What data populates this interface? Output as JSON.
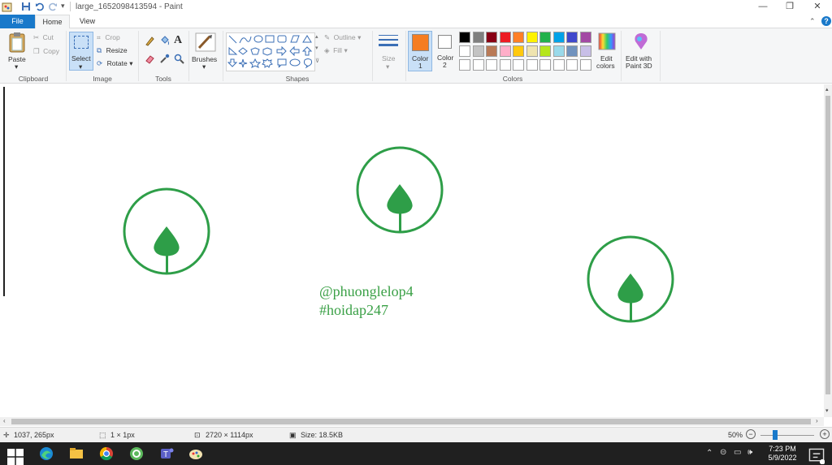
{
  "window": {
    "title": "large_1652098413594 - Paint"
  },
  "tabs": {
    "file": "File",
    "home": "Home",
    "view": "View"
  },
  "clipboard": {
    "paste": "Paste",
    "cut": "Cut",
    "copy": "Copy",
    "label": "Clipboard"
  },
  "image": {
    "select": "Select",
    "crop": "Crop",
    "resize": "Resize",
    "rotate": "Rotate",
    "label": "Image"
  },
  "tools": {
    "label": "Tools"
  },
  "brushes": {
    "label": "Brushes"
  },
  "shapes": {
    "outline": "Outline",
    "fill": "Fill",
    "label": "Shapes"
  },
  "size": {
    "label": "Size"
  },
  "colors": {
    "color1_label": "Color",
    "color1_num": "1",
    "color2_label": "Color",
    "color2_num": "2",
    "color1_value": "#f57d22",
    "color2_value": "#ffffff",
    "edit_colors_1": "Edit",
    "edit_colors_2": "colors",
    "paint3d_1": "Edit with",
    "paint3d_2": "Paint 3D",
    "label": "Colors",
    "palette_row1": [
      "#000000",
      "#7f7f7f",
      "#880015",
      "#ed1c24",
      "#ff7f27",
      "#fff200",
      "#22b14c",
      "#00a2e8",
      "#3f48cc",
      "#a349a4"
    ],
    "palette_row2": [
      "#ffffff",
      "#c3c3c3",
      "#b97a57",
      "#ffaec9",
      "#ffc90e",
      "#efe4b0",
      "#b5e61d",
      "#99d9ea",
      "#7092be",
      "#c8bfe7"
    ]
  },
  "canvas": {
    "line1": "@phuonglelop4",
    "line2": "#hoidap247",
    "accent": "#2e9e48"
  },
  "status": {
    "cursor_pos": "1037, 265px",
    "selection": "1 × 1px",
    "image_size": "2720 × 1114px",
    "file_size": "Size: 18.5KB",
    "zoom": "50%"
  },
  "taskbar": {
    "time": "7:23 PM",
    "date": "5/9/2022"
  }
}
